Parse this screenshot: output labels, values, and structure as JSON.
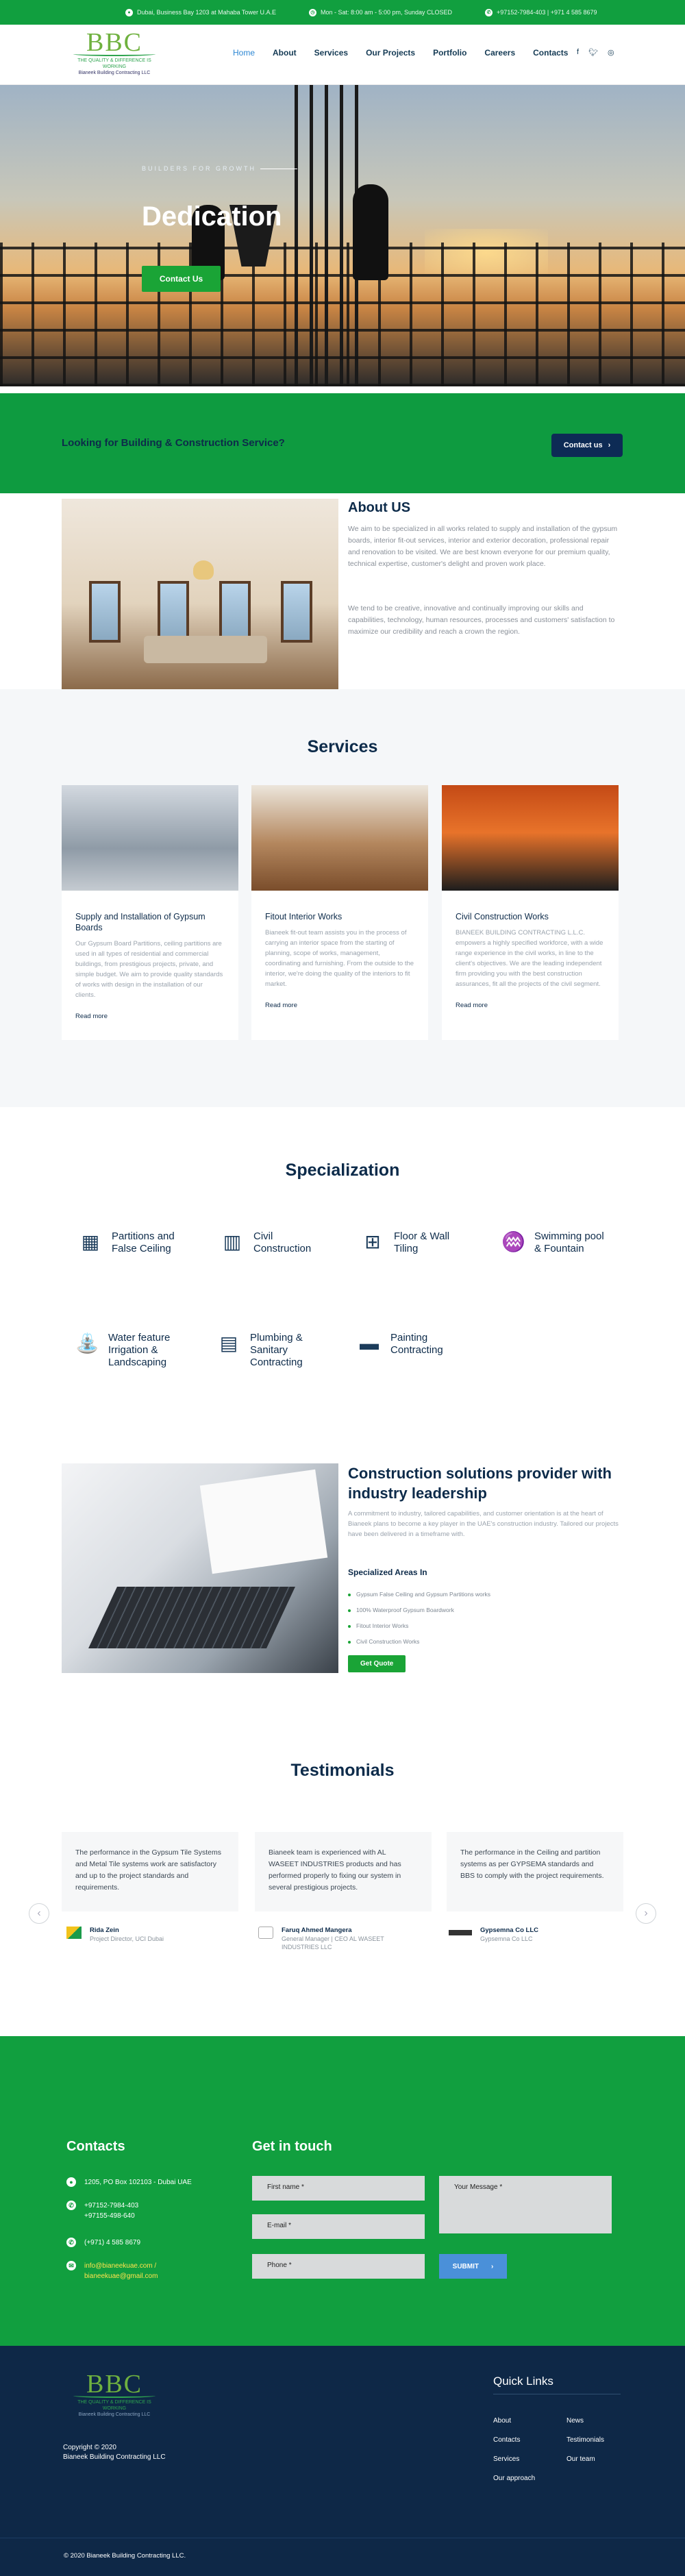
{
  "topbar": {
    "address": "Dubai, Business Bay 1203 at Mahaba Tower U.A.E",
    "hours": "Mon - Sat: 8:00 am - 5:00 pm, Sunday CLOSED",
    "phone": "+97152-7984-403 | +971 4 585 8679"
  },
  "brand": {
    "logo": "BBC",
    "tagline1": "THE QUALITY & DIFFERENCE IS WORKING",
    "tagline2": "Bianeek Building Contracting LLC"
  },
  "nav": [
    "Home",
    "About",
    "Services",
    "Our Projects",
    "Portfolio",
    "Careers",
    "Contacts"
  ],
  "social": [
    "f",
    "t",
    "ig"
  ],
  "hero": {
    "eyebrow": "BUILDERS FOR GROWTH",
    "title": "Dedication",
    "button": "Contact Us"
  },
  "cta": {
    "text": "Looking for Building & Construction Service?",
    "button": "Contact us"
  },
  "about": {
    "title": "About US",
    "p1": "We aim to be specialized in all works related to supply and installation of the gypsum boards, interior fit-out services, interior and exterior decoration, professional repair and renovation to be visited. We are best known everyone for our premium quality, technical expertise, customer's delight and proven work place.",
    "p2": "We tend to be creative, innovative and continually improving our skills and capabilities, technology, human resources, processes and customers' satisfaction to maximize our credibility and reach a crown the region."
  },
  "services": {
    "title": "Services",
    "cards": [
      {
        "title": "Supply and Installation of Gypsum Boards",
        "text": "Our Gypsum Board Partitions, ceiling partitions are used in all types of residential and commercial buildings, from prestigious projects, private, and simple budget. We aim to provide quality standards of works with design in the installation of our clients.",
        "more": "Read more"
      },
      {
        "title": "Fitout Interior Works",
        "text": "Bianeek fit-out team assists you in the process of carrying an interior space from the starting of planning, scope of works, management, coordinating and furnishing. From the outside to the interior, we're doing the quality of the interiors to fit market.",
        "more": "Read more"
      },
      {
        "title": "Civil Construction Works",
        "text": "BIANEEK BUILDING CONTRACTING L.L.C. empowers a highly specified workforce, with a wide range experience in the civil works, in line to the client's objectives. We are the leading independent firm providing you with the best construction assurances, fit all the projects of the civil segment.",
        "more": "Read more"
      }
    ]
  },
  "specialization": {
    "title": "Specialization",
    "items": [
      "Partitions and False Ceiling",
      "Civil Construction",
      "Floor & Wall Tiling",
      "Swimming pool & Fountain",
      "Water feature Irrigation & Landscaping",
      "Plumbing & Sanitary Contracting",
      "Painting Contracting"
    ]
  },
  "solutions": {
    "title": "Construction solutions provider with industry leadership",
    "text": "A commitment to industry, tailored capabilities, and customer orientation is at the heart of Bianeek plans to become a key player in the UAE's construction industry. Tailored our projects have been delivered in a timeframe with.",
    "areas_title": "Specialized Areas In",
    "areas": [
      "Gypsum False Ceiling and Gypsum Partitions works",
      "100% Waterproof Gypsum Boardwork",
      "Fitout Interior Works",
      "Civil Construction Works"
    ],
    "button": "Get Quote"
  },
  "testimonials": {
    "title": "Testimonials",
    "items": [
      {
        "text": "The performance in the Gypsum Tile Systems and Metal Tile systems work are satisfactory and up to the project standards and requirements.",
        "name": "Rida Zein",
        "role": "Project Director, UCI Dubai"
      },
      {
        "text": "Bianeek team is experienced with AL WASEET INDUSTRIES products and has performed properly to fixing our system in several prestigious projects.",
        "name": "Faruq Ahmed Mangera",
        "role": "General Manager | CEO AL WASEET INDUSTRIES LLC"
      },
      {
        "text": "The performance in the Ceiling and partition systems as per GYPSEMA standards and BBS to comply with the project requirements.",
        "name": "Gypsemna Co LLC",
        "role": "Gypsemna Co LLC"
      }
    ]
  },
  "contacts": {
    "title": "Contacts",
    "address": "1205, PO Box 102103 - Dubai UAE",
    "phone1": "+97152-7984-403",
    "phone2": "+97155-498-640",
    "phone3": "(+971) 4 585 8679",
    "email": "info@bianeekuae.com / bianeekuae@gmail.com"
  },
  "form": {
    "title": "Get in touch",
    "first_name": "First name *",
    "email": "E-mail *",
    "phone": "Phone *",
    "message": "Your Message *",
    "submit": "SUBMIT"
  },
  "footer": {
    "copyright": "Copyright © 2020",
    "company": "Bianeek Building Contracting LLC",
    "quick_title": "Quick Links",
    "links": [
      "About",
      "News",
      "Contacts",
      "Testimonials",
      "Services",
      "Our team",
      "Our approach"
    ],
    "bottom": "© 2020 Bianeek Building Contracting LLC."
  },
  "colors": {
    "green": "#119f3f",
    "navy": "#0d2b4a",
    "footer": "#0e2847",
    "link": "#2d87d3"
  }
}
